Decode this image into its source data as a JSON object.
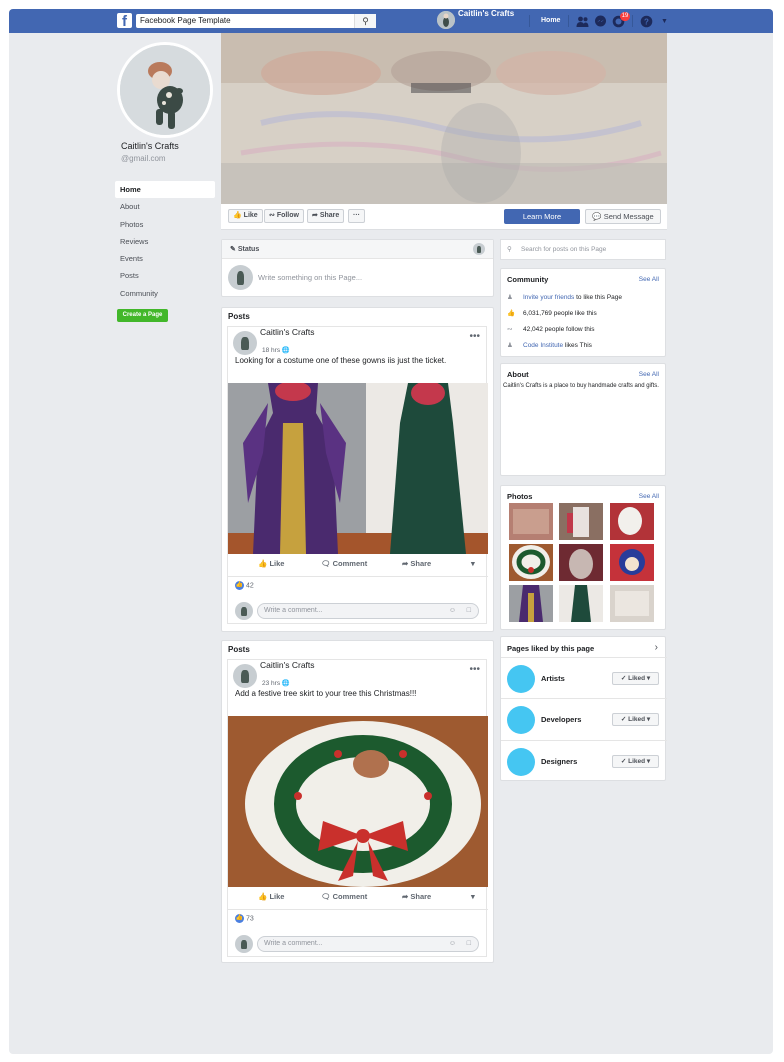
{
  "topbar": {
    "logo": "f",
    "search_value": "Facebook Page Template",
    "page_name": "Caitlin's Crafts",
    "home_label": "Home",
    "notification_count": "19",
    "color": "#4267b2"
  },
  "profile": {
    "name": "Caitlin's Crafts",
    "handle": "@gmail.com"
  },
  "nav": {
    "items": [
      "Home",
      "About",
      "Photos",
      "Reviews",
      "Events",
      "Posts",
      "Community"
    ],
    "create_page": "Create a Page"
  },
  "actions": {
    "like": "Like",
    "follow": "Follow",
    "share": "Share",
    "more": "···",
    "learn_more": "Learn More",
    "send_message": "Send Message"
  },
  "composer": {
    "status_label": "Status",
    "placeholder": "Write something on this Page..."
  },
  "posts": [
    {
      "section_title": "Posts",
      "author": "Caitlin's Crafts",
      "time": "18 hrs",
      "text": "Looking for a costume one of these gowns iis just the ticket.",
      "reactions": "42",
      "like": "Like",
      "comment": "Comment",
      "share": "Share",
      "comment_placeholder": "Write a comment..."
    },
    {
      "section_title": "Posts",
      "author": "Caitlin's Crafts",
      "time": "23 hrs",
      "text": "Add a festive tree skirt to your tree this Christmas!!!",
      "reactions": "73",
      "like": "Like",
      "comment": "Comment",
      "share": "Share",
      "comment_placeholder": "Write a comment..."
    }
  ],
  "right": {
    "search_placeholder": "Search for posts on this Page",
    "community": {
      "title": "Community",
      "see_all": "See All",
      "invite_link": "Invite your friends",
      "invite_rest": " to like this Page",
      "likes": "6,031,769 people like this",
      "follows": "42,042 people follow this",
      "ci_link": "Code Institute",
      "ci_rest": " likes This"
    },
    "about": {
      "title": "About",
      "see_all": "See All",
      "text": "Caitlin's Crafts is a place to buy handmade crafts and gifts."
    },
    "photos": {
      "title": "Photos",
      "see_all": "See All"
    },
    "liked": {
      "title": "Pages liked by this page",
      "items": [
        "Artists",
        "Developers",
        "Designers"
      ],
      "button": "Liked"
    }
  }
}
